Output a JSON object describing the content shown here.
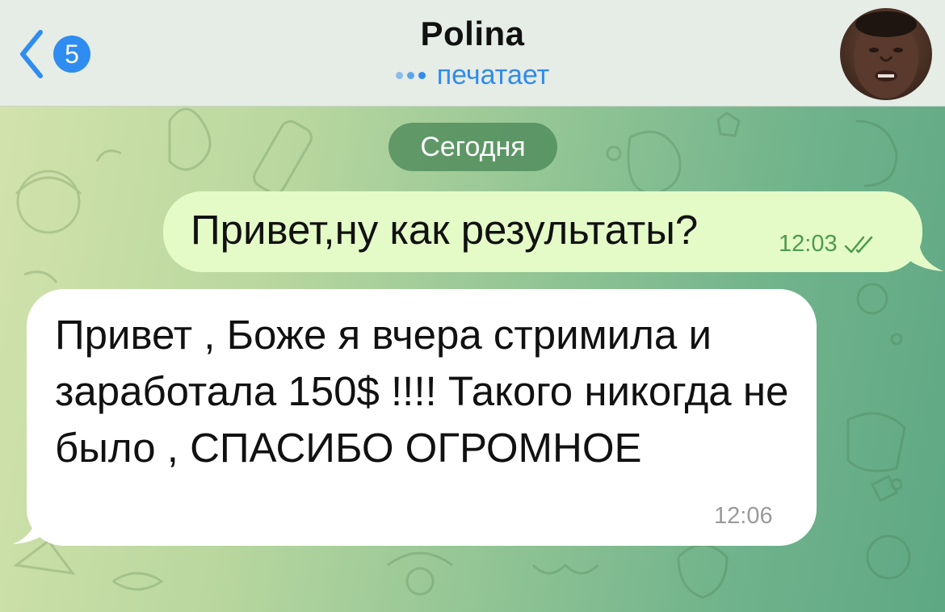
{
  "header": {
    "back_badge": "5",
    "contact_name": "Polina",
    "status": "печатает"
  },
  "date_separator": "Сегодня",
  "messages": [
    {
      "direction": "outgoing",
      "text": "Привет,ну как результаты?",
      "time": "12:03",
      "read_receipt": "double-check-icon"
    },
    {
      "direction": "incoming",
      "text": "Привет , Боже я вчера стримила и заработала 150$ !!!! Такого никогда не было , СПАСИБО ОГРОМНОЕ",
      "time": "12:06"
    }
  ],
  "colors": {
    "accent": "#2f8cf0",
    "outgoing_bubble": "#e4fbc8",
    "incoming_bubble": "#ffffff",
    "outgoing_time": "#4e9a4f",
    "header_bg": "#e6ece6"
  }
}
